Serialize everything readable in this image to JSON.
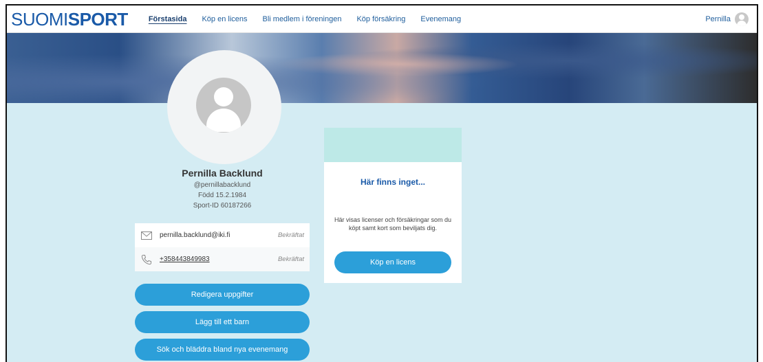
{
  "header": {
    "logo_part1": "SUOMI",
    "logo_part2": "SPORT",
    "nav": [
      {
        "label": "Förstasida",
        "active": true
      },
      {
        "label": "Köp en licens",
        "active": false
      },
      {
        "label": "Bli medlem i föreningen",
        "active": false
      },
      {
        "label": "Köp försäkring",
        "active": false
      },
      {
        "label": "Evenemang",
        "active": false
      }
    ],
    "user_name": "Pernilla"
  },
  "profile": {
    "name": "Pernilla Backlund",
    "handle": "@pernillabacklund",
    "born": "Född 15.2.1984",
    "sport_id": "Sport-ID 60187266",
    "contacts": [
      {
        "icon": "envelope-icon",
        "value": "pernilla.backlund@iki.fi",
        "status": "Bekräftat"
      },
      {
        "icon": "phone-icon",
        "value": "+358443849983",
        "status": "Bekräftat"
      }
    ],
    "buttons": {
      "edit": "Redigera uppgifter",
      "add_child": "Lägg till ett barn",
      "browse_events": "Sök och bläddra bland nya evenemang"
    }
  },
  "card": {
    "title": "Här finns inget...",
    "text": "Här visas licenser och försäkringar som du köpt samt kort som beviljats dig.",
    "button": "Köp en licens"
  },
  "colors": {
    "brand_blue": "#1a5aa8",
    "button_blue": "#2c9fd9",
    "page_bg": "#d4ecf3",
    "card_accent": "#bde9e7"
  }
}
